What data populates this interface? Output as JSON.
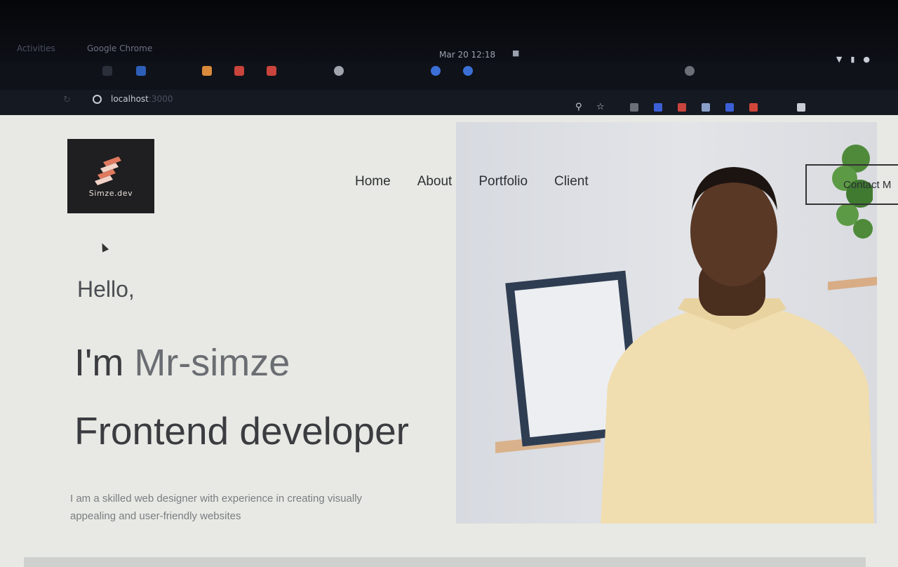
{
  "os": {
    "activities": "Activities",
    "app_name": "Google Chrome",
    "clock": "Mar 20  12:18"
  },
  "browser": {
    "url_host": "localhost",
    "url_port": ":3000"
  },
  "site": {
    "logo_text": "Simze.dev",
    "nav": [
      "Home",
      "About",
      "Portfolio",
      "Client"
    ],
    "contact_label": "Contact M",
    "hello": "Hello,",
    "intro_prefix": "I'm ",
    "intro_name": "Mr-simze",
    "role": "Frontend developer",
    "description": "I am a skilled web designer with experience in creating visually appealing and user-friendly websites"
  },
  "colors": {
    "logo_bg": "#1f1e20",
    "logo_accent": "#e07a5f",
    "page_bg": "#e8e9e4",
    "shirt": "#f0deb0"
  }
}
